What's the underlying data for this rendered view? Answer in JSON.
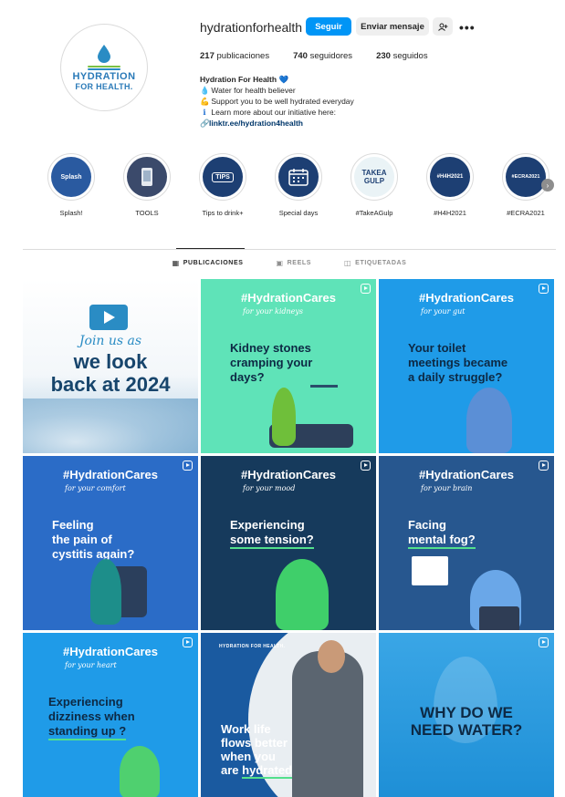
{
  "profile": {
    "username": "hydrationforhealth",
    "avatar_line1": "HYDRATION",
    "avatar_line2": "FOR HEALTH.",
    "follow_label": "Seguir",
    "message_label": "Enviar mensaje",
    "add_icon": "person-add-icon",
    "more_icon": "more-icon",
    "stats": {
      "posts_count": "217",
      "posts_label": "publicaciones",
      "followers_count": "740",
      "followers_label": "seguidores",
      "following_count": "230",
      "following_label": "seguidos"
    },
    "bio": {
      "name": "Hydration For Health",
      "line1": "Water for health believer",
      "line2": "Support you to be well hydrated everyday",
      "line3": "Learn more about our initiative here:",
      "link": "linktr.ee/hydration4health"
    }
  },
  "highlights": [
    {
      "label": "Splash!",
      "cover": "Splash",
      "color": "#2a5aa0"
    },
    {
      "label": "TOOLS",
      "cover": "",
      "color": "#3b4a6b"
    },
    {
      "label": "Tips to drink+",
      "cover": "TIPS",
      "color": "#1d3f73"
    },
    {
      "label": "Special days",
      "cover": "",
      "color": "#1d3f73"
    },
    {
      "label": "#TakeAGulp",
      "cover": "TAKEA GULP",
      "color": "#eaf3f6"
    },
    {
      "label": "#H4H2021",
      "cover": "#H4H2021",
      "color": "#1d3f73"
    },
    {
      "label": "#ECRA2021",
      "cover": "#ECRA2021",
      "color": "#1d3f73"
    }
  ],
  "tabs": [
    {
      "label": "PUBLICACIONES",
      "icon": "grid-icon",
      "active": true
    },
    {
      "label": "REELS",
      "icon": "reels-icon",
      "active": false
    },
    {
      "label": "ETIQUETADAS",
      "icon": "tagged-icon",
      "active": false
    }
  ],
  "posts": {
    "p1": {
      "line1": "Join us as",
      "line2": "we look",
      "line3": "back at 2024"
    },
    "p2": {
      "tag": "#HydrationCares",
      "sub": "for your kidneys",
      "head1": "Kidney stones",
      "head2": "cramping your",
      "head3": "days?"
    },
    "p3": {
      "tag": "#HydrationCares",
      "sub": "for your gut",
      "head1": "Your toilet",
      "head2": "meetings became",
      "head3": "a daily struggle?"
    },
    "p4": {
      "tag": "#HydrationCares",
      "sub": "for your comfort",
      "head1": "Feeling",
      "head2": "the pain of",
      "head3": "cystitis again?"
    },
    "p5": {
      "tag": "#HydrationCares",
      "sub": "for your mood",
      "head1": "Experiencing",
      "head2": "some tension?"
    },
    "p6": {
      "tag": "#HydrationCares",
      "sub": "for your brain",
      "head1": "Facing",
      "head2": "mental fog?"
    },
    "p7": {
      "tag": "#HydrationCares",
      "sub": "for your heart",
      "head1": "Experiencing",
      "head2": "dizziness when",
      "head3": "standing up ?"
    },
    "p8": {
      "logo": "HYDRATION FOR HEALTH.",
      "head1": "Work life",
      "head2": "flows better",
      "head3": "when you",
      "head4a": "are ",
      "head4b": "hydrated"
    },
    "p9": {
      "line1": "WHY DO WE",
      "line2": "NEED WATER?"
    }
  }
}
